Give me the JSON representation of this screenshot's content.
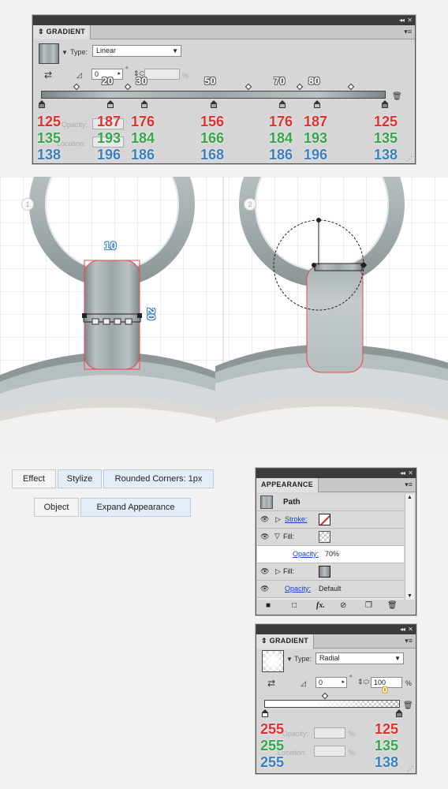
{
  "gradient_panel_1": {
    "title": "GRADIENT",
    "type_label": "Type:",
    "type_value": "Linear",
    "angle_value": "0",
    "degree_symbol": "°",
    "percent_symbol": "%",
    "opacity_label": "Opacity:",
    "location_label": "Location:",
    "positions": [
      "20",
      "30",
      "50",
      "70",
      "80"
    ],
    "red_values": [
      "125",
      "187",
      "176",
      "156",
      "176",
      "187",
      "125"
    ],
    "green_values": [
      "135",
      "193",
      "184",
      "166",
      "184",
      "193",
      "135"
    ],
    "blue_values": [
      "138",
      "196",
      "186",
      "168",
      "186",
      "196",
      "138"
    ]
  },
  "step_1": {
    "badge": "1",
    "width_label": "10",
    "height_label": "20"
  },
  "step_2": {
    "badge": "2"
  },
  "menu_path_1": {
    "effect": "Effect",
    "stylize": "Stylize",
    "rounded": "Rounded Corners: 1px"
  },
  "menu_path_2": {
    "object": "Object",
    "expand": "Expand Appearance"
  },
  "appearance_panel": {
    "title": "APPEARANCE",
    "path_label": "Path",
    "stroke_label": "Stroke:",
    "fill_label_1": "Fill:",
    "opacity_label_1": "Opacity:",
    "opacity_value_1": "70%",
    "fill_label_2": "Fill:",
    "opacity_label_2": "Opacity:",
    "opacity_value_2": "Default",
    "fx_label": "fx."
  },
  "gradient_panel_2": {
    "title": "GRADIENT",
    "type_label": "Type:",
    "type_value": "Radial",
    "angle_value": "0",
    "degree_symbol": "°",
    "ratio_value": "100",
    "percent_symbol": "%",
    "opacity_label": "Opacity:",
    "location_label": "Location:",
    "position_marker": "0",
    "red_values": [
      "255",
      "125"
    ],
    "green_values": [
      "255",
      "135"
    ],
    "blue_values": [
      "255",
      "138"
    ]
  },
  "colors": {
    "red": "#e03030",
    "green": "#36a64a",
    "blue": "#3a7fc0",
    "panel": "#d6d6d6",
    "selection": "#e84a4a"
  }
}
